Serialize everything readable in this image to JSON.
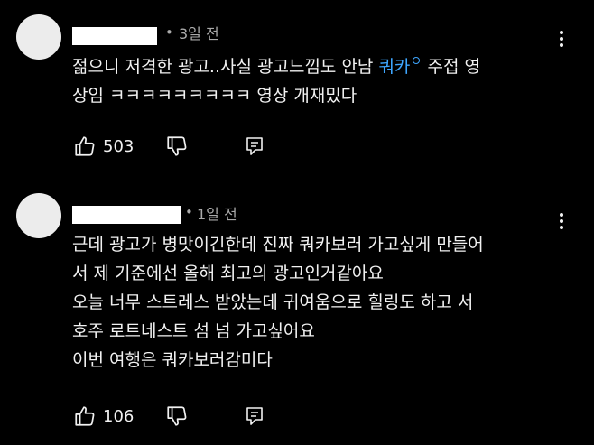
{
  "comments": [
    {
      "time": "3일 전",
      "dot": "•",
      "text_line1_a": "젊으니 저격한 광고..사실 광고느낌도 안남 ",
      "hashtag": "쿼카",
      "text_line1_b": " 주접 영",
      "text_line2": "상임 ㅋㅋㅋㅋㅋㅋㅋㅋㅋ 영상 개재밌다",
      "likes": "503"
    },
    {
      "time": "1일 전",
      "dot": "•",
      "lines": [
        "근데 광고가 병맛이긴한데 진짜 쿼카보러 가고싶게 만들어",
        "서 제 기준에선 올해 최고의 광고인거같아요",
        "오늘 너무 스트레스 받았는데 귀여움으로 힐링도 하고 서",
        "호주 로트네스트 섬 넘 가고싶어요",
        "이번 여행은 쿼카보러감미다"
      ],
      "likes": "106"
    }
  ],
  "icons": {
    "like": "thumbs-up-icon",
    "dislike": "thumbs-down-icon",
    "reply": "reply-icon",
    "menu": "more-vertical-icon",
    "hashtag": "search-hashtag-icon"
  },
  "colors": {
    "background": "#000000",
    "text": "#f1f1f1",
    "secondary": "#aaaaaa",
    "hashtag": "#3ea6ff"
  }
}
